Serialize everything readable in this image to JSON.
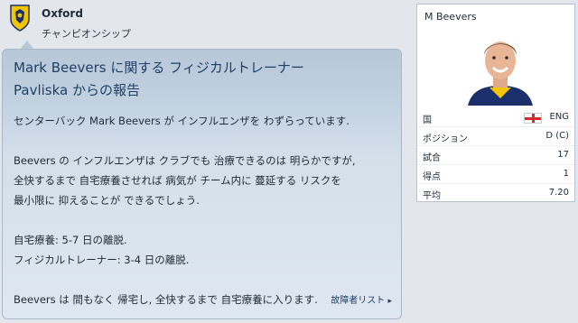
{
  "club": {
    "name": "Oxford",
    "league": "チャンピオンシップ"
  },
  "message": {
    "title_line1": "Mark Beevers に関する フィジカルトレーナー",
    "title_line2": "Pavliska からの報告",
    "body": [
      "センターバック Mark Beevers が インフルエンザを わずらっています.",
      "",
      "Beevers の インフルエンザは クラブでも 治療できるのは 明らかですが,",
      "全快するまで 自宅療養させれば 病気が チーム内に 蔓延する リスクを",
      "最小限に 抑えることが できるでしょう.",
      "",
      "自宅療養: 5-7 日の離脱.",
      "フィジカルトレーナー: 3-4 日の離脱.",
      "",
      "Beevers は 間もなく 帰宅し, 全快するまで 自宅療養に入ります."
    ],
    "link_label": "故障者リスト"
  },
  "player": {
    "name": "M Beevers",
    "stats": [
      {
        "label": "国",
        "value": "ENG",
        "flag": "england-flag"
      },
      {
        "label": "ポジション",
        "value": "D (C)"
      },
      {
        "label": "試合",
        "value": "17"
      },
      {
        "label": "得点",
        "value": "1"
      },
      {
        "label": "平均",
        "value": "7.20"
      }
    ]
  },
  "colors": {
    "title": "#1f3f66",
    "panel_top": "#b7c7d8",
    "panel_bottom": "#dfe8f1",
    "flag_red": "#d62b2b"
  }
}
